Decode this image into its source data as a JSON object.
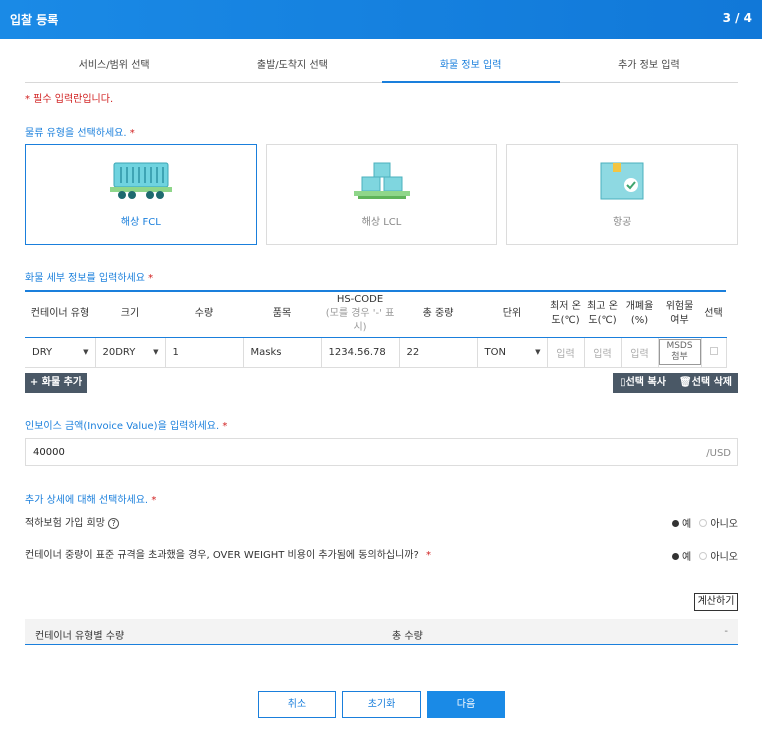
{
  "header": {
    "title": "입찰 등록",
    "step": "3 / 4"
  },
  "tabs": [
    "서비스/범위 선택",
    "출발/도착지 선택",
    "화물 정보 입력",
    "추가 정보 입력"
  ],
  "required_note": "* 필수 입력란입니다.",
  "logistics": {
    "label": "물류 유형을 선택하세요.",
    "options": [
      {
        "label": "해상 FCL",
        "icon": "container-ship-icon",
        "selected": true
      },
      {
        "label": "해상 LCL",
        "icon": "boxes-on-pallet-icon",
        "selected": false
      },
      {
        "label": "항공",
        "icon": "package-box-icon",
        "selected": false
      }
    ]
  },
  "cargo": {
    "label": "화물 세부 정보를 입력하세요",
    "headers": [
      "컨테이너 유형",
      "크기",
      "수량",
      "품목",
      "HS-CODE",
      "총 중량",
      "단위",
      "최저 온도(℃)",
      "최고 온도(℃)",
      "개폐율(%)",
      "위험물 여부",
      "선택"
    ],
    "hs_code_hint": "(모를 경우 '-' 표시)",
    "rows": [
      {
        "container_type": "DRY",
        "size": "20DRY",
        "quantity": "1",
        "item": "Masks",
        "hs_code": "1234.56.78",
        "total_weight": "22",
        "unit": "TON",
        "min_temp": "입력",
        "max_temp": "입력",
        "vent": "입력",
        "hazard": "MSDS 첨부"
      }
    ],
    "add_button": "+ 화물 추가",
    "copy_button": "선택 복사",
    "delete_button": "선택 삭제"
  },
  "invoice": {
    "label": "인보이스 금액(Invoice Value)을 입력하세요.",
    "value": "40000",
    "unit": "/USD"
  },
  "details": {
    "label": "추가 상세에 대해 선택하세요.",
    "questions": [
      {
        "text": "적하보험 가입 희망",
        "yes": "예",
        "no": "아니오",
        "selected": "yes"
      },
      {
        "text": "컨테이너 중량이 표준 규격을 초과했을 경우, OVER WEIGHT 비용이 추가됨에 동의하십니까?",
        "yes": "예",
        "no": "아니오",
        "selected": "yes"
      }
    ]
  },
  "calculate_button": "계산하기",
  "summary": {
    "left": "컨테이너 유형별 수량",
    "center": "총 수량",
    "right": "-"
  },
  "footer": {
    "cancel": "취소",
    "reset": "초기화",
    "next": "다음"
  },
  "colors": {
    "accent": "#1a7fdc",
    "required": "#d12020",
    "dark_button": "#4a5866"
  }
}
